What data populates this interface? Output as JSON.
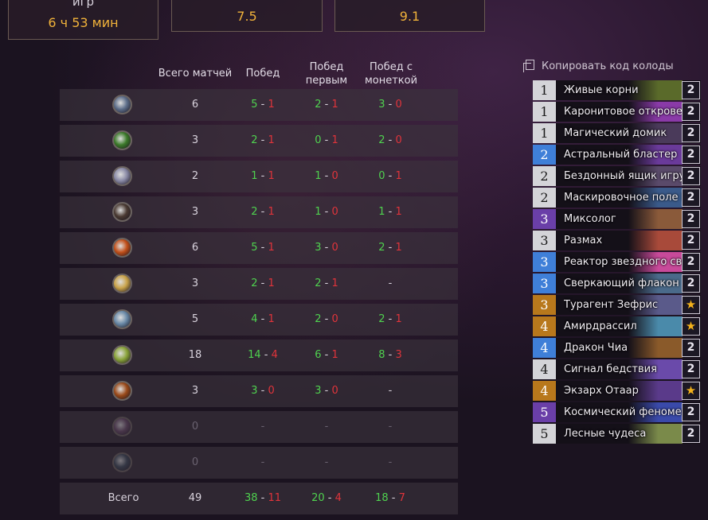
{
  "top": {
    "box1": {
      "label": "игр",
      "value": "6 ч 53 мин"
    },
    "box2": {
      "label": "",
      "value": "7.5"
    },
    "box3": {
      "label": "",
      "value": "9.1"
    }
  },
  "headers": {
    "total": "Всего матчей",
    "wins": "Побед",
    "first": "Побед первым",
    "coin": "Побед с монеткой"
  },
  "rows": [
    {
      "hero": "mage-hero-icon",
      "color": "#5d6e8a",
      "total": "6",
      "w": [
        "5",
        "1"
      ],
      "f": [
        "2",
        "1"
      ],
      "c": [
        "3",
        "0"
      ]
    },
    {
      "hero": "druid-hero-icon",
      "color": "#3c7a2a",
      "total": "3",
      "w": [
        "2",
        "1"
      ],
      "f": [
        "0",
        "1"
      ],
      "c": [
        "2",
        "0"
      ]
    },
    {
      "hero": "shaman-hero-icon",
      "color": "#8a8aa6",
      "total": "2",
      "w": [
        "1",
        "1"
      ],
      "f": [
        "1",
        "0"
      ],
      "c": [
        "0",
        "1"
      ]
    },
    {
      "hero": "rogue-hero-icon",
      "color": "#4a3a32",
      "total": "3",
      "w": [
        "2",
        "1"
      ],
      "f": [
        "1",
        "0"
      ],
      "c": [
        "1",
        "1"
      ]
    },
    {
      "hero": "warlock-hero-icon",
      "color": "#c2501a",
      "total": "6",
      "w": [
        "5",
        "1"
      ],
      "f": [
        "3",
        "0"
      ],
      "c": [
        "2",
        "1"
      ]
    },
    {
      "hero": "paladin-hero-icon",
      "color": "#c9a34a",
      "total": "3",
      "w": [
        "2",
        "1"
      ],
      "f": [
        "2",
        "1"
      ],
      "c": null
    },
    {
      "hero": "hunter-hero-icon",
      "color": "#6a8aa8",
      "total": "5",
      "w": [
        "4",
        "1"
      ],
      "f": [
        "2",
        "0"
      ],
      "c": [
        "2",
        "1"
      ]
    },
    {
      "hero": "demon-hunter-hero-icon",
      "color": "#8aa43a",
      "total": "18",
      "w": [
        "14",
        "4"
      ],
      "f": [
        "6",
        "1"
      ],
      "c": [
        "8",
        "3"
      ]
    },
    {
      "hero": "warrior-hero-icon",
      "color": "#9a4a1a",
      "total": "3",
      "w": [
        "3",
        "0"
      ],
      "f": [
        "3",
        "0"
      ],
      "c": null
    },
    {
      "hero": "priest-hero-icon",
      "color": "#6a4a6a",
      "total": "0",
      "w": null,
      "f": null,
      "c": null,
      "dim": true
    },
    {
      "hero": "death-knight-hero-icon",
      "color": "#3a4a5a",
      "total": "0",
      "w": null,
      "f": null,
      "c": null,
      "dim": true
    }
  ],
  "totals": {
    "label": "Всего",
    "total": "49",
    "w": [
      "38",
      "11"
    ],
    "f": [
      "20",
      "4"
    ],
    "c": [
      "18",
      "7"
    ]
  },
  "dash": "-",
  "copy_label": "Копировать код колоды",
  "cards": [
    {
      "cost": "1",
      "name": "Живые корни",
      "count": "2",
      "rarity": "common",
      "art": "#5a6a2a"
    },
    {
      "cost": "1",
      "name": "Каронитовое откровение",
      "count": "2",
      "rarity": "common",
      "art": "#8a3aa8"
    },
    {
      "cost": "1",
      "name": "Магический домик",
      "count": "2",
      "rarity": "common",
      "art": "#4a3a5a"
    },
    {
      "cost": "2",
      "name": "Астральный бластер",
      "count": "2",
      "rarity": "rare",
      "art": "#6a3a9a"
    },
    {
      "cost": "2",
      "name": "Бездонный ящик игрушек",
      "count": "2",
      "rarity": "common",
      "art": "#5a4a6a"
    },
    {
      "cost": "2",
      "name": "Маскировочное поле Ц",
      "count": "2",
      "rarity": "common",
      "art": "#3a5a8a"
    },
    {
      "cost": "3",
      "name": "Миксолог",
      "count": "2",
      "rarity": "epic",
      "art": "#8a5a3a"
    },
    {
      "cost": "3",
      "name": "Размах",
      "count": "2",
      "rarity": "common",
      "art": "#a84a3a"
    },
    {
      "cost": "3",
      "name": "Реактор звездного света",
      "count": "2",
      "rarity": "rare",
      "art": "#c84a9a"
    },
    {
      "cost": "3",
      "name": "Сверкающий флакон",
      "count": "2",
      "rarity": "rare",
      "art": "#4a6a8a"
    },
    {
      "cost": "3",
      "name": "Турагент Зефрис",
      "count": "★",
      "rarity": "legendary",
      "art": "#5a5a8a"
    },
    {
      "cost": "4",
      "name": "Амирдрассил",
      "count": "★",
      "rarity": "legendary",
      "art": "#4a8aaa"
    },
    {
      "cost": "4",
      "name": "Дракон Чиа",
      "count": "2",
      "rarity": "rare",
      "art": "#8a5a2a"
    },
    {
      "cost": "4",
      "name": "Сигнал бедствия",
      "count": "2",
      "rarity": "common",
      "art": "#6a4aaa"
    },
    {
      "cost": "4",
      "name": "Экзарх Отаар",
      "count": "★",
      "rarity": "legendary",
      "art": "#5a3a8a"
    },
    {
      "cost": "5",
      "name": "Космический феномен",
      "count": "2",
      "rarity": "epic",
      "art": "#3a4aaa"
    },
    {
      "cost": "5",
      "name": "Лесные чудеса",
      "count": "2",
      "rarity": "common",
      "art": "#7a8a4a"
    }
  ],
  "rarity_colors": {
    "common": "#d4d4d8",
    "rare": "#3f7fd8",
    "epic": "#6a3fa8",
    "legendary": "#b8781c"
  }
}
